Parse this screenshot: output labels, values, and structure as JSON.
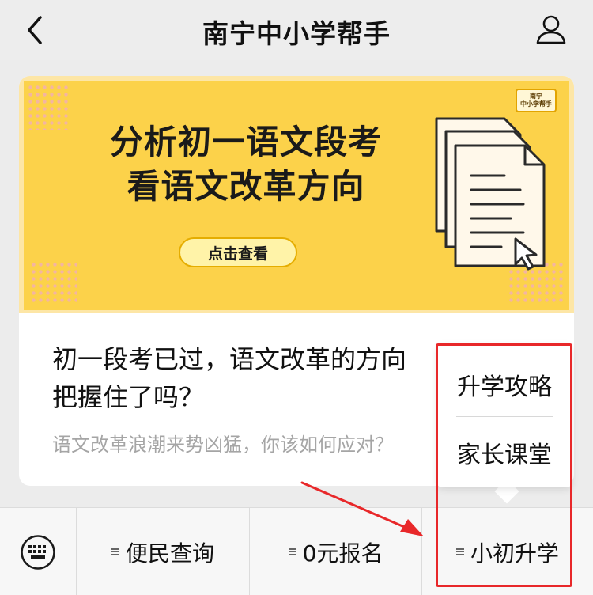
{
  "header": {
    "title": "南宁中小学帮手",
    "back_icon": "chevron-left-icon",
    "profile_icon": "user-icon"
  },
  "article": {
    "banner": {
      "line1": "分析初一语文段考",
      "line2": "看语文改革方向",
      "cta": "点击查看",
      "badge_line1": "南宁",
      "badge_line2": "中小学帮手",
      "bg_color": "#fcd24a"
    },
    "title_line1": "初一段考已过，语文改革的方向",
    "title_line2": "把握住了吗？",
    "description": "语文改革浪潮来势凶猛，你该如何应对？"
  },
  "popup_menu": {
    "items": [
      {
        "label": "升学攻略"
      },
      {
        "label": "家长课堂"
      }
    ]
  },
  "bottom_menu": {
    "keyboard_icon": "keyboard-icon",
    "items": [
      {
        "label": "便民查询"
      },
      {
        "label": "0元报名"
      },
      {
        "label": "小初升学"
      }
    ]
  },
  "annotation": {
    "highlight_color": "#e8282a"
  }
}
